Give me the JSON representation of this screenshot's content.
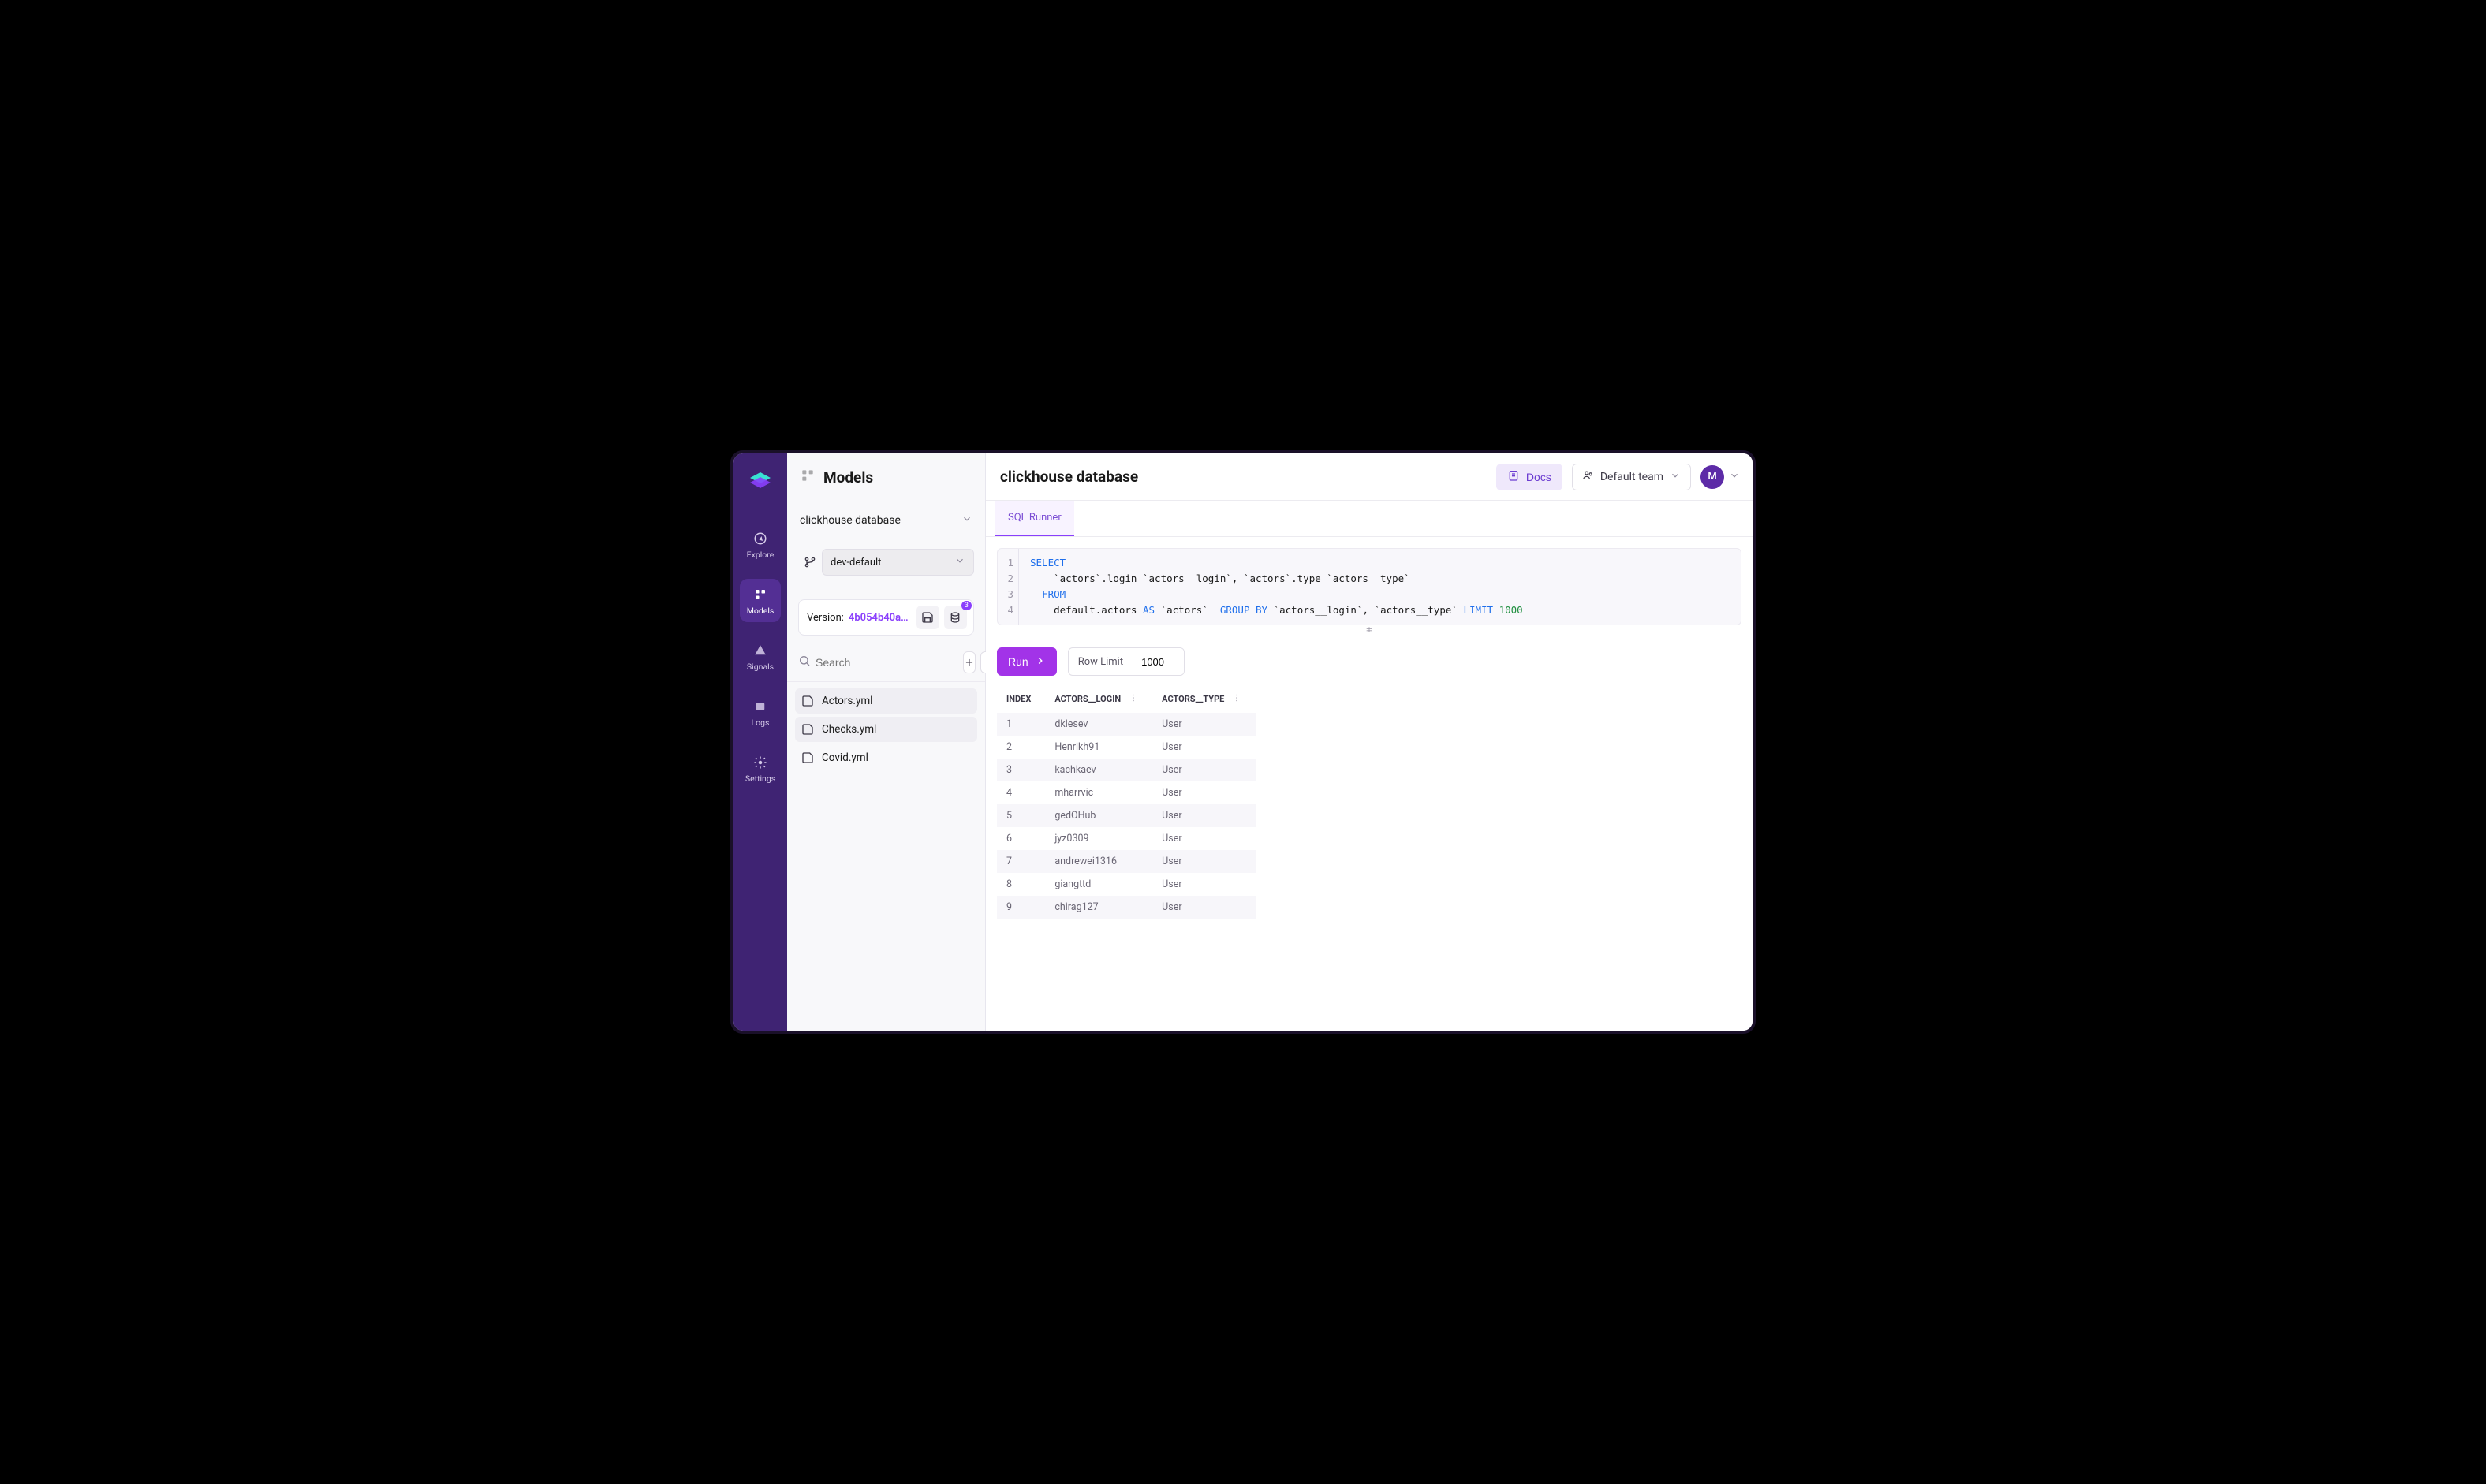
{
  "gnav": {
    "items": [
      {
        "id": "explore",
        "label": "Explore"
      },
      {
        "id": "models",
        "label": "Models"
      },
      {
        "id": "signals",
        "label": "Signals"
      },
      {
        "id": "logs",
        "label": "Logs"
      },
      {
        "id": "settings",
        "label": "Settings"
      }
    ],
    "active": "models"
  },
  "left": {
    "section_title": "Models",
    "database": "clickhouse database",
    "branch": "dev-default",
    "version_label": "Version:",
    "version_hash": "4b054b40aa…",
    "pending_badge": "3",
    "search_placeholder": "Search",
    "files": [
      {
        "name": "Actors.yml"
      },
      {
        "name": "Checks.yml"
      },
      {
        "name": "Covid.yml"
      }
    ]
  },
  "header": {
    "title": "clickhouse database",
    "docs_label": "Docs",
    "team_label": "Default team",
    "avatar_initial": "M"
  },
  "tabbar": {
    "active_tab": "SQL Runner"
  },
  "editor": {
    "lines": [
      {
        "n": "1",
        "tokens": [
          {
            "t": "SELECT",
            "c": "kw"
          }
        ]
      },
      {
        "n": "2",
        "tokens": [
          {
            "t": "    `actors`.login `actors__login`, `actors`.type `actors__type`",
            "c": ""
          }
        ]
      },
      {
        "n": "3",
        "tokens": [
          {
            "t": "  ",
            "c": ""
          },
          {
            "t": "FROM",
            "c": "kw"
          }
        ]
      },
      {
        "n": "4",
        "tokens": [
          {
            "t": "    default.actors ",
            "c": ""
          },
          {
            "t": "AS",
            "c": "kw"
          },
          {
            "t": " `actors`  ",
            "c": ""
          },
          {
            "t": "GROUP BY",
            "c": "kw"
          },
          {
            "t": " `actors__login`, `actors__type` ",
            "c": ""
          },
          {
            "t": "LIMIT",
            "c": "kw"
          },
          {
            "t": " ",
            "c": ""
          },
          {
            "t": "1000",
            "c": "lim"
          }
        ]
      }
    ]
  },
  "controls": {
    "run_label": "Run",
    "row_limit_label": "Row Limit",
    "row_limit_value": "1000"
  },
  "results": {
    "columns": [
      "INDEX",
      "ACTORS__LOGIN",
      "ACTORS__TYPE"
    ],
    "rows": [
      {
        "index": "1",
        "login": "dklesev",
        "type": "User"
      },
      {
        "index": "2",
        "login": "Henrikh91",
        "type": "User"
      },
      {
        "index": "3",
        "login": "kachkaev",
        "type": "User"
      },
      {
        "index": "4",
        "login": "mharrvic",
        "type": "User"
      },
      {
        "index": "5",
        "login": "gedOHub",
        "type": "User"
      },
      {
        "index": "6",
        "login": "jyz0309",
        "type": "User"
      },
      {
        "index": "7",
        "login": "andrewei1316",
        "type": "User"
      },
      {
        "index": "8",
        "login": "giangttd",
        "type": "User"
      },
      {
        "index": "9",
        "login": "chirag127",
        "type": "User"
      }
    ]
  }
}
